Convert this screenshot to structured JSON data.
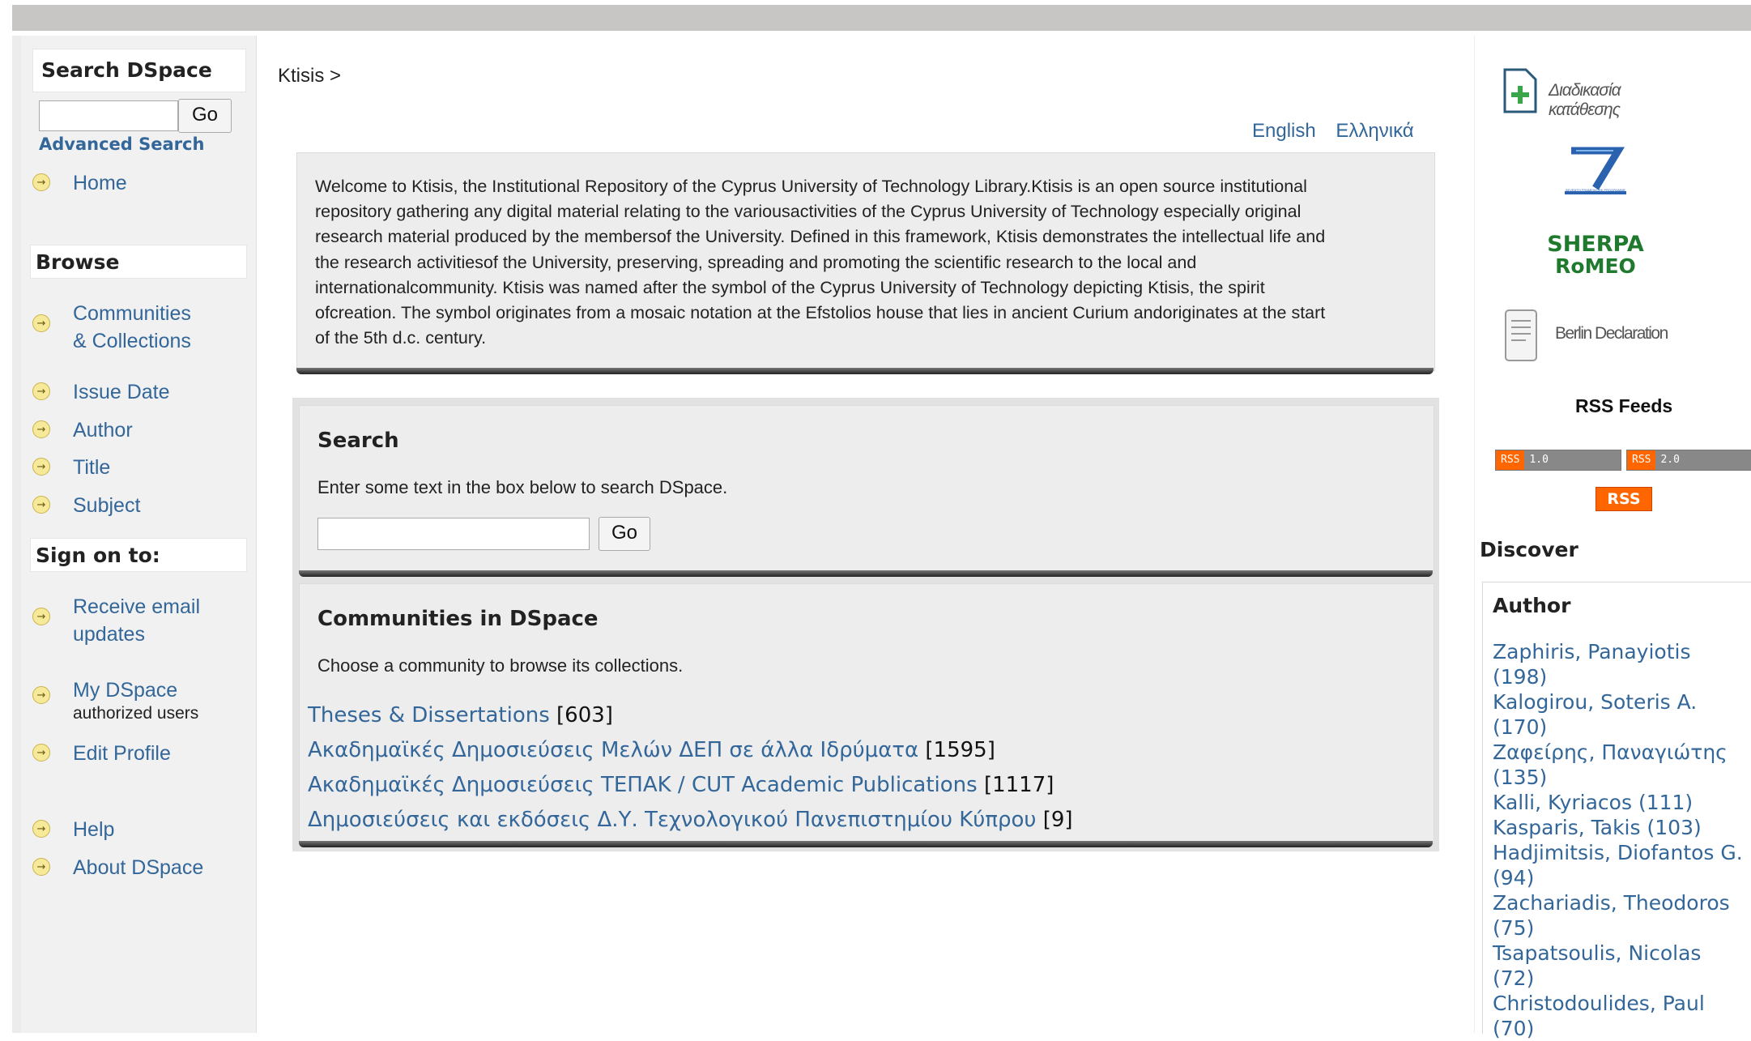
{
  "sidebar": {
    "search_title": "Search DSpace",
    "go_label": "Go",
    "advanced_search": "Advanced Search",
    "home": "Home",
    "browse_title": "Browse",
    "browse_items": [
      {
        "line1": "Communities",
        "line2": "& Collections"
      },
      {
        "line1": "Issue Date"
      },
      {
        "line1": "Author"
      },
      {
        "line1": "Title"
      },
      {
        "line1": "Subject"
      }
    ],
    "signon_title": "Sign on to:",
    "signon_items": [
      {
        "line1": "Receive email",
        "line2": "updates"
      },
      {
        "line1": "My DSpace",
        "sub": "authorized users"
      },
      {
        "line1": "Edit Profile"
      }
    ],
    "help": "Help",
    "about": "About DSpace"
  },
  "main": {
    "breadcrumb": "Ktisis >",
    "lang_english": "English",
    "lang_greek": "Ελληνικά",
    "welcome_lines": [
      "Welcome to Ktisis, the Institutional Repository of the Cyprus University of Technology Library.Ktisis is an open source institutional",
      "repository gathering any digital material relating to the variousactivities of the Cyprus University of Technology especially original",
      "research material produced by the membersof the University. Defined in this framework, Ktisis demonstrates the intellectual life and",
      "the research activitiesof the University, preserving, spreading and promoting the scientific research to the local and",
      "internationalcommunity. Ktisis was named after the symbol of the Cyprus University of Technology depicting Ktisis, the spirit",
      "ofcreation. The symbol originates from a mosaic notation at the Efstolios house that lies in ancient Curium andoriginates at the start",
      "of the 5th d.c. century."
    ],
    "search_title": "Search",
    "search_hint": "Enter some text in the box below to search DSpace.",
    "go_label": "Go",
    "communities_title": "Communities in DSpace",
    "communities_hint": "Choose a community to browse its collections.",
    "communities": [
      {
        "name": "Theses & Dissertations",
        "count": "[603]"
      },
      {
        "name": "Ακαδημαϊκές Δημοσιεύσεις Μελών ΔΕΠ σε άλλα Ιδρύματα",
        "count": "[1595]"
      },
      {
        "name": "Ακαδημαϊκές Δημοσιεύσεις ΤΕΠΑΚ / CUT Academic Publications",
        "count": "[1117]"
      },
      {
        "name": "Δημοσιεύσεις και εκδόσεις Δ.Υ. Τεχνολογικού Πανεπιστημίου Κύπρου",
        "count": "[9]"
      }
    ]
  },
  "right": {
    "deposit_label": "Διαδικασία κατάθεσης",
    "fp7_label": "SEVENTH FRAMEWORK PROGRAMME",
    "sherpa_line1": "SHERPA",
    "sherpa_line2": "RoMEO",
    "berlin_label": "Berlin Declaration",
    "rss_title": "RSS Feeds",
    "rss1_left": "RSS",
    "rss1_right": "1.0",
    "rss2_left": "RSS",
    "rss2_right": "2.0",
    "rss_plain": "RSS",
    "discover_title": "Discover",
    "author_title": "Author",
    "authors": [
      {
        "name": "Zaphiris, Panayiotis",
        "count": "(198)"
      },
      {
        "name": "Kalogirou, Soteris A.",
        "count": "(170)"
      },
      {
        "name": "Ζαφείρης, Παναγιώτης",
        "count": "(135)"
      },
      {
        "name": "Kalli, Kyriacos",
        "count": "(111)"
      },
      {
        "name": "Kasparis, Takis",
        "count": "(103)"
      },
      {
        "name": "Hadjimitsis, Diofantos G.",
        "count": "(94)"
      },
      {
        "name": "Zachariadis, Theodoros",
        "count": "(75)"
      },
      {
        "name": "Tsapatsoulis, Nicolas",
        "count": "(72)"
      },
      {
        "name": "Christodoulides, Paul",
        "count": "(70)"
      }
    ]
  }
}
